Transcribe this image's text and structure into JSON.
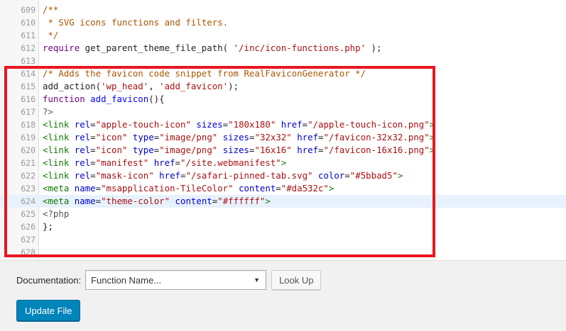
{
  "editor": {
    "lines": [
      {
        "num": "609",
        "tokens": [
          {
            "t": "/**",
            "c": "comment"
          }
        ]
      },
      {
        "num": "610",
        "tokens": [
          {
            "t": " * SVG icons functions and filters.",
            "c": "comment"
          }
        ]
      },
      {
        "num": "611",
        "tokens": [
          {
            "t": " */",
            "c": "comment"
          }
        ]
      },
      {
        "num": "612",
        "tokens": [
          {
            "t": "require",
            "c": "keyword"
          },
          {
            "t": " get_parent_theme_file_path( ",
            "c": "plain"
          },
          {
            "t": "'/inc/icon-functions.php'",
            "c": "string"
          },
          {
            "t": " );",
            "c": "plain"
          }
        ]
      },
      {
        "num": "613",
        "tokens": []
      },
      {
        "num": "614",
        "tokens": [
          {
            "t": "/* Adds the favicon code snippet from RealFaviconGenerator */",
            "c": "comment"
          }
        ]
      },
      {
        "num": "615",
        "tokens": [
          {
            "t": "add_action(",
            "c": "plain"
          },
          {
            "t": "'wp_head'",
            "c": "string"
          },
          {
            "t": ", ",
            "c": "plain"
          },
          {
            "t": "'add_favicon'",
            "c": "string"
          },
          {
            "t": ");",
            "c": "plain"
          }
        ]
      },
      {
        "num": "616",
        "tokens": [
          {
            "t": "function",
            "c": "keyword"
          },
          {
            "t": " ",
            "c": "plain"
          },
          {
            "t": "add_favicon",
            "c": "def"
          },
          {
            "t": "(){",
            "c": "plain"
          }
        ]
      },
      {
        "num": "617",
        "tokens": [
          {
            "t": "?>",
            "c": "meta"
          }
        ]
      },
      {
        "num": "618",
        "tokens": [
          {
            "t": "<link",
            "c": "tag"
          },
          {
            "t": " ",
            "c": "plain"
          },
          {
            "t": "rel",
            "c": "attr"
          },
          {
            "t": "=",
            "c": "plain"
          },
          {
            "t": "\"apple-touch-icon\"",
            "c": "string"
          },
          {
            "t": " ",
            "c": "plain"
          },
          {
            "t": "sizes",
            "c": "attr"
          },
          {
            "t": "=",
            "c": "plain"
          },
          {
            "t": "\"180x180\"",
            "c": "string"
          },
          {
            "t": " ",
            "c": "plain"
          },
          {
            "t": "href",
            "c": "attr"
          },
          {
            "t": "=",
            "c": "plain"
          },
          {
            "t": "\"/apple-touch-icon.png\"",
            "c": "string"
          },
          {
            "t": ">",
            "c": "tag"
          }
        ]
      },
      {
        "num": "619",
        "tokens": [
          {
            "t": "<link",
            "c": "tag"
          },
          {
            "t": " ",
            "c": "plain"
          },
          {
            "t": "rel",
            "c": "attr"
          },
          {
            "t": "=",
            "c": "plain"
          },
          {
            "t": "\"icon\"",
            "c": "string"
          },
          {
            "t": " ",
            "c": "plain"
          },
          {
            "t": "type",
            "c": "attr"
          },
          {
            "t": "=",
            "c": "plain"
          },
          {
            "t": "\"image/png\"",
            "c": "string"
          },
          {
            "t": " ",
            "c": "plain"
          },
          {
            "t": "sizes",
            "c": "attr"
          },
          {
            "t": "=",
            "c": "plain"
          },
          {
            "t": "\"32x32\"",
            "c": "string"
          },
          {
            "t": " ",
            "c": "plain"
          },
          {
            "t": "href",
            "c": "attr"
          },
          {
            "t": "=",
            "c": "plain"
          },
          {
            "t": "\"/favicon-32x32.png\"",
            "c": "string"
          },
          {
            "t": ">",
            "c": "tag"
          }
        ]
      },
      {
        "num": "620",
        "tokens": [
          {
            "t": "<link",
            "c": "tag"
          },
          {
            "t": " ",
            "c": "plain"
          },
          {
            "t": "rel",
            "c": "attr"
          },
          {
            "t": "=",
            "c": "plain"
          },
          {
            "t": "\"icon\"",
            "c": "string"
          },
          {
            "t": " ",
            "c": "plain"
          },
          {
            "t": "type",
            "c": "attr"
          },
          {
            "t": "=",
            "c": "plain"
          },
          {
            "t": "\"image/png\"",
            "c": "string"
          },
          {
            "t": " ",
            "c": "plain"
          },
          {
            "t": "sizes",
            "c": "attr"
          },
          {
            "t": "=",
            "c": "plain"
          },
          {
            "t": "\"16x16\"",
            "c": "string"
          },
          {
            "t": " ",
            "c": "plain"
          },
          {
            "t": "href",
            "c": "attr"
          },
          {
            "t": "=",
            "c": "plain"
          },
          {
            "t": "\"/favicon-16x16.png\"",
            "c": "string"
          },
          {
            "t": ">",
            "c": "tag"
          }
        ]
      },
      {
        "num": "621",
        "tokens": [
          {
            "t": "<link",
            "c": "tag"
          },
          {
            "t": " ",
            "c": "plain"
          },
          {
            "t": "rel",
            "c": "attr"
          },
          {
            "t": "=",
            "c": "plain"
          },
          {
            "t": "\"manifest\"",
            "c": "string"
          },
          {
            "t": " ",
            "c": "plain"
          },
          {
            "t": "href",
            "c": "attr"
          },
          {
            "t": "=",
            "c": "plain"
          },
          {
            "t": "\"/site.webmanifest\"",
            "c": "string"
          },
          {
            "t": ">",
            "c": "tag"
          }
        ]
      },
      {
        "num": "622",
        "tokens": [
          {
            "t": "<link",
            "c": "tag"
          },
          {
            "t": " ",
            "c": "plain"
          },
          {
            "t": "rel",
            "c": "attr"
          },
          {
            "t": "=",
            "c": "plain"
          },
          {
            "t": "\"mask-icon\"",
            "c": "string"
          },
          {
            "t": " ",
            "c": "plain"
          },
          {
            "t": "href",
            "c": "attr"
          },
          {
            "t": "=",
            "c": "plain"
          },
          {
            "t": "\"/safari-pinned-tab.svg\"",
            "c": "string"
          },
          {
            "t": " ",
            "c": "plain"
          },
          {
            "t": "color",
            "c": "attr"
          },
          {
            "t": "=",
            "c": "plain"
          },
          {
            "t": "\"#5bbad5\"",
            "c": "string"
          },
          {
            "t": ">",
            "c": "tag"
          }
        ]
      },
      {
        "num": "623",
        "tokens": [
          {
            "t": "<meta",
            "c": "tag"
          },
          {
            "t": " ",
            "c": "plain"
          },
          {
            "t": "name",
            "c": "attr"
          },
          {
            "t": "=",
            "c": "plain"
          },
          {
            "t": "\"msapplication-TileColor\"",
            "c": "string"
          },
          {
            "t": " ",
            "c": "plain"
          },
          {
            "t": "content",
            "c": "attr"
          },
          {
            "t": "=",
            "c": "plain"
          },
          {
            "t": "\"#da532c\"",
            "c": "string"
          },
          {
            "t": ">",
            "c": "tag"
          }
        ]
      },
      {
        "num": "624",
        "active": true,
        "tokens": [
          {
            "t": "<meta",
            "c": "tag"
          },
          {
            "t": " ",
            "c": "plain"
          },
          {
            "t": "name",
            "c": "attr"
          },
          {
            "t": "=",
            "c": "plain"
          },
          {
            "t": "\"theme-color\"",
            "c": "string"
          },
          {
            "t": " ",
            "c": "plain"
          },
          {
            "t": "content",
            "c": "attr"
          },
          {
            "t": "=",
            "c": "plain"
          },
          {
            "t": "\"#ffffff\"",
            "c": "string"
          },
          {
            "t": ">",
            "c": "tag"
          }
        ]
      },
      {
        "num": "625",
        "tokens": [
          {
            "t": "<?php",
            "c": "meta"
          }
        ]
      },
      {
        "num": "626",
        "tokens": [
          {
            "t": "};",
            "c": "plain"
          }
        ]
      },
      {
        "num": "627",
        "tokens": []
      },
      {
        "num": "628",
        "tokens": []
      }
    ]
  },
  "documentation": {
    "label": "Documentation:",
    "select_value": "Function Name...",
    "lookup_label": "Look Up"
  },
  "update_label": "Update File",
  "colors": {
    "highlight_box": "#e8171f",
    "primary_button": "#0085ba",
    "active_line": "#e8f2fe"
  },
  "icons": {
    "select_arrow": "chevron-down-icon"
  }
}
